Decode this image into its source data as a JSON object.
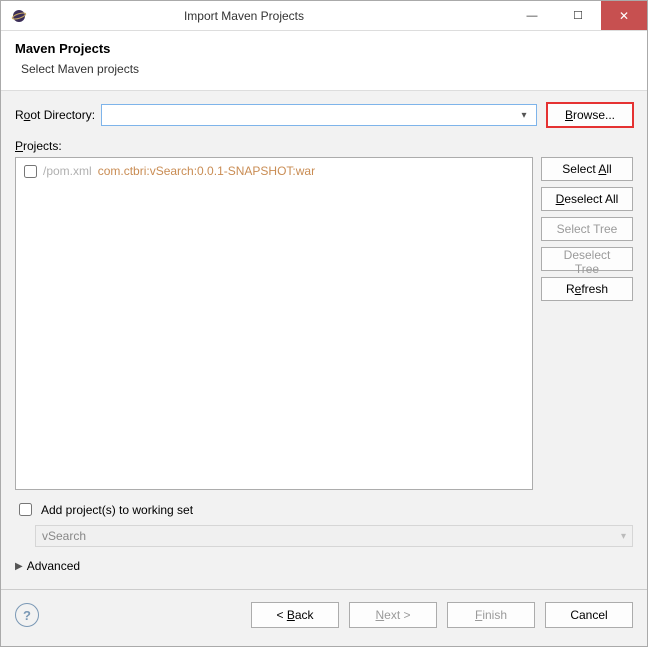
{
  "window": {
    "title": "Import Maven Projects"
  },
  "banner": {
    "title": "Maven Projects",
    "subtitle": "Select Maven projects"
  },
  "labels": {
    "rootDirectory_pre": "R",
    "rootDirectory_u": "o",
    "rootDirectory_post": "ot Directory:",
    "browse_u": "B",
    "browse_post": "rowse...",
    "projects_u": "P",
    "projects_post": "rojects:",
    "selectAll_pre": "Select ",
    "selectAll_u": "A",
    "selectAll_post": "ll",
    "deselectAll_u": "D",
    "deselectAll_post": "eselect All",
    "selectTree": "Select Tree",
    "deselectTree": "Deselect Tree",
    "refresh_pre": "R",
    "refresh_u": "e",
    "refresh_post": "fresh",
    "addWorking": "Add project(s) to working set",
    "advanced": "Advanced",
    "back_pre": "< ",
    "back_u": "B",
    "back_post": "ack",
    "next_u": "N",
    "next_post": "ext >",
    "finish_u": "F",
    "finish_post": "inish",
    "cancel": "Cancel"
  },
  "rootDirectory": {
    "value": ""
  },
  "projects": {
    "items": [
      {
        "checked": false,
        "pom": "/pom.xml",
        "gav": "com.ctbri:vSearch:0.0.1-SNAPSHOT:war"
      }
    ]
  },
  "workingSet": {
    "checked": false,
    "value": "vSearch"
  }
}
